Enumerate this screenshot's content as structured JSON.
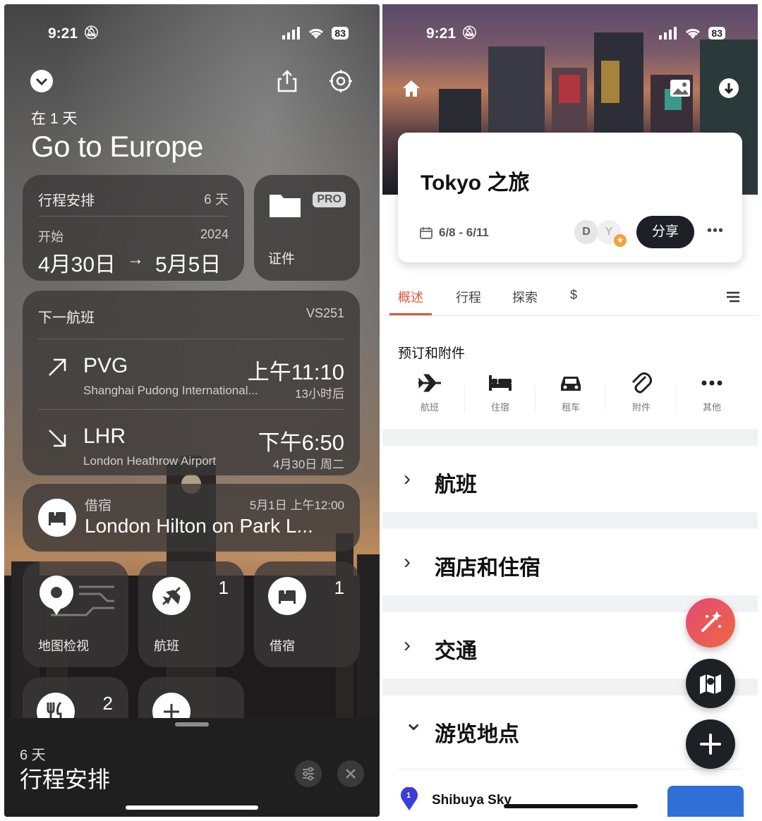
{
  "left": {
    "status": {
      "time": "9:21",
      "battery": "83"
    },
    "header": {
      "subtitle": "在 1 天",
      "title": "Go to Europe"
    },
    "schedule_card": {
      "title": "行程安排",
      "days": "6 天",
      "start_label": "开始",
      "year": "2024",
      "range_start": "4月30日",
      "arrow": "→",
      "range_end": "5月5日"
    },
    "docs_card": {
      "badge": "PRO",
      "label": "证件"
    },
    "flight_card": {
      "title": "下一航班",
      "code": "VS251",
      "departure": {
        "airport_code": "PVG",
        "time": "上午11:10",
        "airport_name": "Shanghai Pudong International...",
        "relative": "13小时后"
      },
      "arrival": {
        "airport_code": "LHR",
        "time": "下午6:50",
        "airport_name": "London Heathrow Airport",
        "date": "4月30日 周二"
      }
    },
    "lodging_card": {
      "label": "借宿",
      "datetime": "5月1日 上午12:00",
      "name": "London Hilton on Park L..."
    },
    "tiles": [
      {
        "label": "地图检视",
        "icon": "map-pin-icon",
        "count": ""
      },
      {
        "label": "航班",
        "icon": "airplane-icon",
        "count": "1"
      },
      {
        "label": "借宿",
        "icon": "bed-icon",
        "count": "1"
      },
      {
        "label": "",
        "icon": "fork-knife-icon",
        "count": "2"
      },
      {
        "label": "",
        "icon": "plus-icon",
        "count": ""
      }
    ],
    "sheet": {
      "days": "6 天",
      "title": "行程安排"
    }
  },
  "right": {
    "status": {
      "time": "9:21",
      "battery": "83"
    },
    "trip": {
      "title": "Tokyo 之旅",
      "dates": "6/8 - 6/11",
      "avatars": [
        "D",
        "Y"
      ],
      "share_label": "分享",
      "more": "•••"
    },
    "tabs": [
      "概述",
      "行程",
      "探索",
      "$"
    ],
    "active_tab": 0,
    "bookings": {
      "title": "预订和附件",
      "items": [
        {
          "label": "航班",
          "icon": "airplane-icon"
        },
        {
          "label": "住宿",
          "icon": "bed-icon"
        },
        {
          "label": "租车",
          "icon": "car-icon"
        },
        {
          "label": "附件",
          "icon": "paperclip-icon"
        },
        {
          "label": "其他",
          "icon": "more-icon"
        }
      ]
    },
    "sections": [
      {
        "label": "航班",
        "chevron": "›"
      },
      {
        "label": "酒店和住宿",
        "chevron": "›"
      },
      {
        "label": "交通",
        "chevron": "›"
      },
      {
        "label": "游览地点",
        "chevron": "⌄"
      }
    ],
    "place": {
      "index": "1",
      "name": "Shibuya Sky"
    },
    "colors": {
      "accent": "#e2553e",
      "dark": "#1d2024",
      "fab_gradient_start": "#e24a77",
      "fab_gradient_end": "#f0673f"
    }
  }
}
